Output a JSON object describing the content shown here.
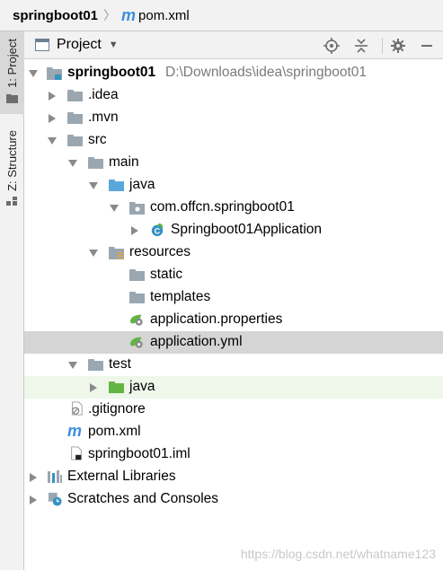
{
  "nav": {
    "project": "springboot01",
    "file_icon_glyph": "m",
    "file": "pom.xml"
  },
  "sidebar": {
    "tab_project": "1: Project",
    "tab_structure": "Z: Structure"
  },
  "panel": {
    "title": "Project"
  },
  "tree": {
    "root_name": "springboot01",
    "root_path": "D:\\Downloads\\idea\\springboot01",
    "idea": ".idea",
    "mvn": ".mvn",
    "src": "src",
    "main": "main",
    "java": "java",
    "package": "com.offcn.springboot01",
    "app_class": "Springboot01Application",
    "resources": "resources",
    "static": "static",
    "templates": "templates",
    "app_props": "application.properties",
    "app_yml": "application.yml",
    "test": "test",
    "test_java": "java",
    "gitignore": ".gitignore",
    "pom_glyph": "m",
    "pom": "pom.xml",
    "iml": "springboot01.iml",
    "ext_libs": "External Libraries",
    "scratches": "Scratches and Consoles"
  },
  "watermark": "https://blog.csdn.net/whatname123",
  "colors": {
    "selection": "#d5d5d5",
    "test_source_bg": "#eef7ea",
    "folder_grey": "#9aa7b0",
    "folder_blue": "#5ba7d9",
    "folder_green": "#62b543",
    "maven_blue": "#3e8ede"
  }
}
